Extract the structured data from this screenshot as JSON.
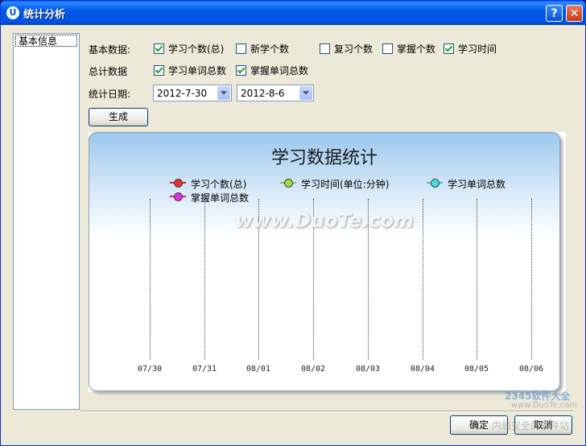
{
  "window": {
    "title": "统计分析"
  },
  "sidebar": {
    "items": [
      {
        "label": "基本信息"
      }
    ]
  },
  "form": {
    "basic_label": "基本数据:",
    "total_label": "总计数据",
    "date_label": "统计日期:",
    "basic_checks": [
      {
        "label": "学习个数(总)",
        "checked": true
      },
      {
        "label": "新学个数",
        "checked": false
      },
      {
        "label": "复习个数",
        "checked": false
      },
      {
        "label": "掌握个数",
        "checked": false
      },
      {
        "label": "学习时间",
        "checked": true
      }
    ],
    "total_checks": [
      {
        "label": "学习单词总数",
        "checked": true
      },
      {
        "label": "掌握单词总数",
        "checked": true
      }
    ],
    "start_date": "2012-7-30",
    "end_date": "2012-8-6",
    "generate_label": "生成"
  },
  "chart_data": {
    "type": "line",
    "title": "学习数据统计",
    "categories": [
      "07/30",
      "07/31",
      "08/01",
      "08/02",
      "08/03",
      "08/04",
      "08/05",
      "08/06"
    ],
    "series": [
      {
        "name": "学习个数(总)",
        "color": "#d62020"
      },
      {
        "name": "学习时间(单位:分钟)",
        "color": "#8ac43b"
      },
      {
        "name": "学习单词总数",
        "color": "#33c7c7"
      },
      {
        "name": "掌握单词总数",
        "color": "#cc22cc"
      }
    ],
    "legend_position": "top",
    "grid": "vertical-dotted"
  },
  "watermark": "www.DuoTe.com",
  "footer": {
    "ok_label": "确定",
    "cancel_label": "取消"
  },
  "corner_watermark": {
    "line1": "2345软件大全",
    "line2": "www.DuoTe.com",
    "line3": "内最安全的软件站"
  }
}
